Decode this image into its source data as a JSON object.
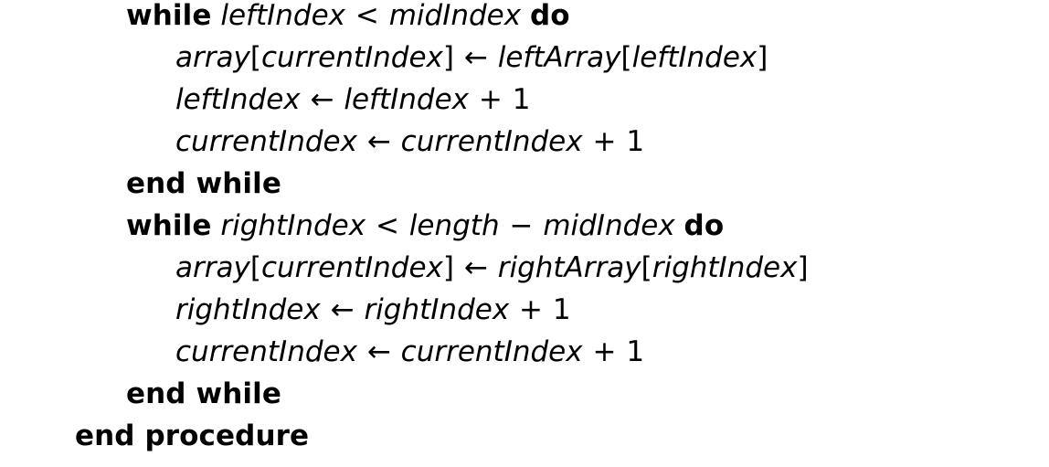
{
  "document": {
    "kind": "pseudocode-listing",
    "background_color": "#ffffff",
    "text_color": "#000000",
    "lines": [
      {
        "indent": 1,
        "tokens": [
          {
            "type": "keyword",
            "text": "while"
          },
          {
            "type": "space",
            "text": " "
          },
          {
            "type": "identifier",
            "text": "leftIndex"
          },
          {
            "type": "space",
            "text": " "
          },
          {
            "type": "operator",
            "text": "<"
          },
          {
            "type": "space",
            "text": " "
          },
          {
            "type": "identifier",
            "text": "midIndex"
          },
          {
            "type": "space",
            "text": " "
          },
          {
            "type": "keyword",
            "text": "do"
          }
        ]
      },
      {
        "indent": 2,
        "tokens": [
          {
            "type": "identifier",
            "text": "array"
          },
          {
            "type": "bracket",
            "text": "["
          },
          {
            "type": "identifier",
            "text": "currentIndex"
          },
          {
            "type": "bracket",
            "text": "]"
          },
          {
            "type": "space",
            "text": " "
          },
          {
            "type": "operator",
            "text": "←"
          },
          {
            "type": "space",
            "text": " "
          },
          {
            "type": "identifier",
            "text": "leftArray"
          },
          {
            "type": "bracket",
            "text": "["
          },
          {
            "type": "identifier",
            "text": "leftIndex"
          },
          {
            "type": "bracket",
            "text": "]"
          }
        ]
      },
      {
        "indent": 2,
        "tokens": [
          {
            "type": "identifier",
            "text": "leftIndex"
          },
          {
            "type": "space",
            "text": " "
          },
          {
            "type": "operator",
            "text": "←"
          },
          {
            "type": "space",
            "text": " "
          },
          {
            "type": "identifier",
            "text": "leftIndex"
          },
          {
            "type": "space",
            "text": " "
          },
          {
            "type": "operator",
            "text": "+"
          },
          {
            "type": "space",
            "text": " "
          },
          {
            "type": "number",
            "text": "1"
          }
        ]
      },
      {
        "indent": 2,
        "tokens": [
          {
            "type": "identifier",
            "text": "currentIndex"
          },
          {
            "type": "space",
            "text": " "
          },
          {
            "type": "operator",
            "text": "←"
          },
          {
            "type": "space",
            "text": " "
          },
          {
            "type": "identifier",
            "text": "currentIndex"
          },
          {
            "type": "space",
            "text": " "
          },
          {
            "type": "operator",
            "text": "+"
          },
          {
            "type": "space",
            "text": " "
          },
          {
            "type": "number",
            "text": "1"
          }
        ]
      },
      {
        "indent": 1,
        "tokens": [
          {
            "type": "keyword",
            "text": "end while"
          }
        ]
      },
      {
        "indent": 1,
        "tokens": [
          {
            "type": "keyword",
            "text": "while"
          },
          {
            "type": "space",
            "text": " "
          },
          {
            "type": "identifier",
            "text": "rightIndex"
          },
          {
            "type": "space",
            "text": " "
          },
          {
            "type": "operator",
            "text": "<"
          },
          {
            "type": "space",
            "text": " "
          },
          {
            "type": "identifier",
            "text": "length"
          },
          {
            "type": "space",
            "text": " "
          },
          {
            "type": "operator",
            "text": "−"
          },
          {
            "type": "space",
            "text": " "
          },
          {
            "type": "identifier",
            "text": "midIndex"
          },
          {
            "type": "space",
            "text": " "
          },
          {
            "type": "keyword",
            "text": "do"
          }
        ]
      },
      {
        "indent": 2,
        "tokens": [
          {
            "type": "identifier",
            "text": "array"
          },
          {
            "type": "bracket",
            "text": "["
          },
          {
            "type": "identifier",
            "text": "currentIndex"
          },
          {
            "type": "bracket",
            "text": "]"
          },
          {
            "type": "space",
            "text": " "
          },
          {
            "type": "operator",
            "text": "←"
          },
          {
            "type": "space",
            "text": " "
          },
          {
            "type": "identifier",
            "text": "rightArray"
          },
          {
            "type": "bracket",
            "text": "["
          },
          {
            "type": "identifier",
            "text": "rightIndex"
          },
          {
            "type": "bracket",
            "text": "]"
          }
        ]
      },
      {
        "indent": 2,
        "tokens": [
          {
            "type": "identifier",
            "text": "rightIndex"
          },
          {
            "type": "space",
            "text": " "
          },
          {
            "type": "operator",
            "text": "←"
          },
          {
            "type": "space",
            "text": " "
          },
          {
            "type": "identifier",
            "text": "rightIndex"
          },
          {
            "type": "space",
            "text": " "
          },
          {
            "type": "operator",
            "text": "+"
          },
          {
            "type": "space",
            "text": " "
          },
          {
            "type": "number",
            "text": "1"
          }
        ]
      },
      {
        "indent": 2,
        "tokens": [
          {
            "type": "identifier",
            "text": "currentIndex"
          },
          {
            "type": "space",
            "text": " "
          },
          {
            "type": "operator",
            "text": "←"
          },
          {
            "type": "space",
            "text": " "
          },
          {
            "type": "identifier",
            "text": "currentIndex"
          },
          {
            "type": "space",
            "text": " "
          },
          {
            "type": "operator",
            "text": "+"
          },
          {
            "type": "space",
            "text": " "
          },
          {
            "type": "number",
            "text": "1"
          }
        ]
      },
      {
        "indent": 1,
        "tokens": [
          {
            "type": "keyword",
            "text": "end while"
          }
        ]
      },
      {
        "indent": 0,
        "tokens": [
          {
            "type": "keyword",
            "text": "end procedure"
          }
        ]
      }
    ]
  }
}
